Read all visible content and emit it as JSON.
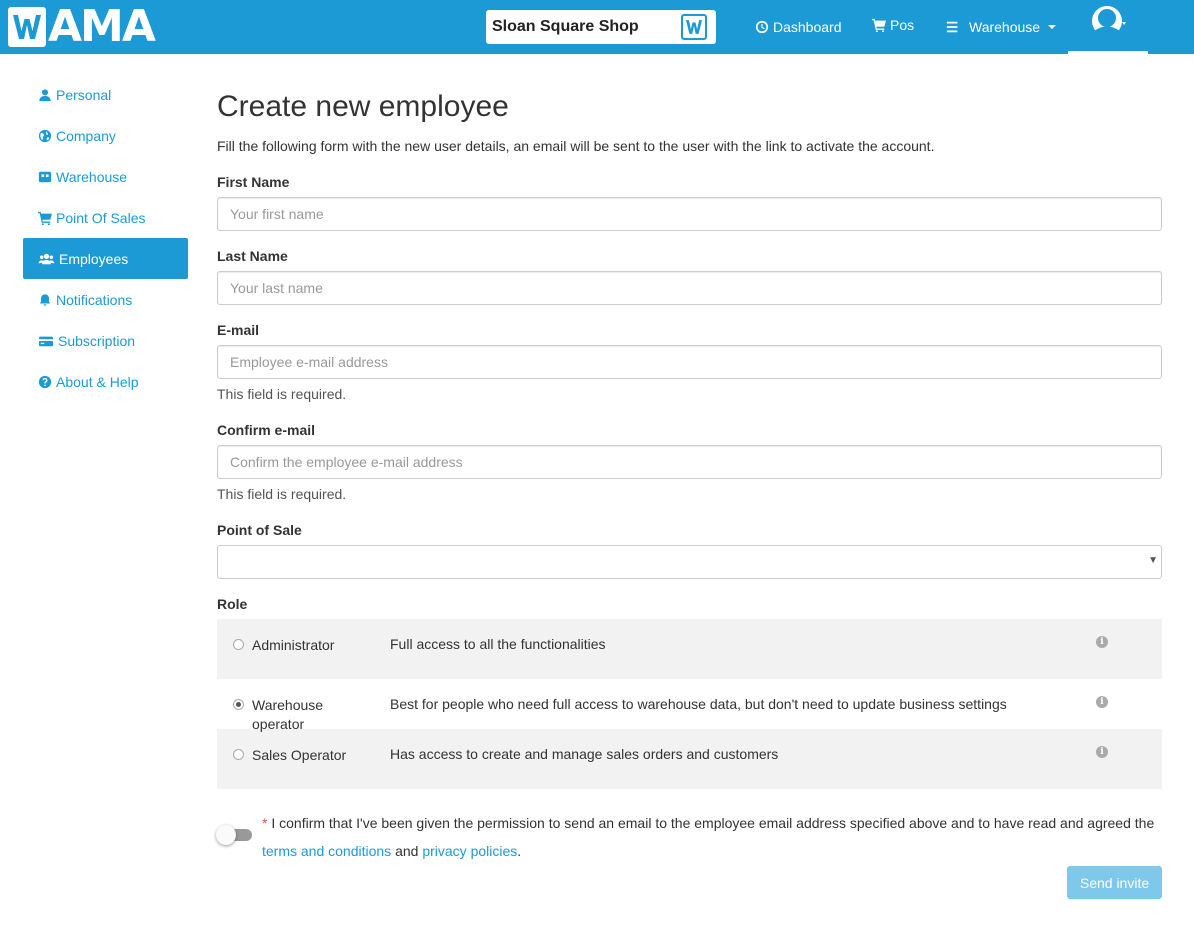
{
  "header": {
    "logo_text": "AMA",
    "shop_name": "Sloan Square Shop",
    "nav": {
      "dashboard": "Dashboard",
      "pos": "Pos",
      "warehouse": "Warehouse"
    },
    "colors": {
      "brand": "#1c9ad6"
    }
  },
  "sidebar": {
    "items": [
      {
        "label": "Personal",
        "icon": "user-icon"
      },
      {
        "label": "Company",
        "icon": "globe-icon"
      },
      {
        "label": "Warehouse",
        "icon": "warehouse-icon"
      },
      {
        "label": "Point Of Sales",
        "icon": "cart-icon"
      },
      {
        "label": "Employees",
        "icon": "users-icon",
        "active": true
      },
      {
        "label": "Notifications",
        "icon": "bell-icon"
      },
      {
        "label": "Subscription",
        "icon": "credit-card-icon"
      },
      {
        "label": "About & Help",
        "icon": "question-icon"
      }
    ]
  },
  "form": {
    "title": "Create new employee",
    "intro": "Fill the following form with the new user details, an email will be sent to the user with the link to activate the account.",
    "first_name": {
      "label": "First Name",
      "placeholder": "Your first name",
      "value": ""
    },
    "last_name": {
      "label": "Last Name",
      "placeholder": "Your last name",
      "value": ""
    },
    "email": {
      "label": "E-mail",
      "placeholder": "Employee e-mail address",
      "value": "",
      "error": "This field is required."
    },
    "confirm_email": {
      "label": "Confirm e-mail",
      "placeholder": "Confirm the employee e-mail address",
      "value": "",
      "error": "This field is required."
    },
    "point_of_sale": {
      "label": "Point of Sale",
      "value": ""
    },
    "role": {
      "label": "Role",
      "options": [
        {
          "name": "Administrator",
          "description": "Full access to all the functionalities",
          "checked": false
        },
        {
          "name": "Warehouse operator",
          "description": "Best for people who need full access to warehouse data, but don't need to update business settings",
          "checked": true
        },
        {
          "name": "Sales Operator",
          "description": "Has access to create and manage sales orders and customers",
          "checked": false
        }
      ]
    },
    "consent": {
      "required_mark": "*",
      "text": " I confirm that I've been given the permission to send an email to the employee email address specified above and to have read and agreed the ",
      "terms_link": "terms and conditions",
      "and": " and ",
      "privacy_link": "privacy policies",
      "end": "."
    },
    "submit_label": "Send invite"
  }
}
